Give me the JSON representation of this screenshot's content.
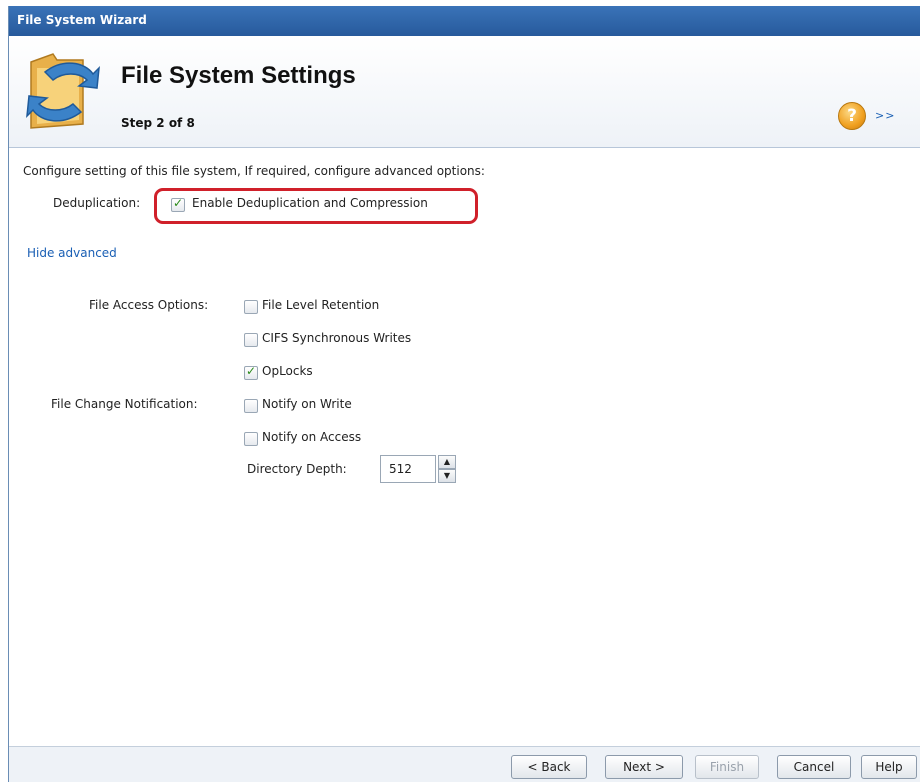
{
  "window": {
    "title": "File System Wizard"
  },
  "header": {
    "title": "File System Settings",
    "step": "Step 2 of 8",
    "help_icon_text": "?",
    "expand_text": ">>"
  },
  "content": {
    "intro": "Configure setting of this file system, If required, configure advanced options:",
    "dedup_label": "Deduplication:",
    "dedup_option": {
      "label": "Enable Deduplication and Compression",
      "checked": true
    },
    "advanced_link": "Hide advanced",
    "file_access_label": "File Access Options:",
    "file_access_options": [
      {
        "label": "File Level Retention",
        "checked": false
      },
      {
        "label": "CIFS Synchronous Writes",
        "checked": false
      },
      {
        "label": "OpLocks",
        "checked": true
      }
    ],
    "file_change_label": "File Change Notification:",
    "file_change_options": [
      {
        "label": "Notify on Write",
        "checked": false
      },
      {
        "label": "Notify on Access",
        "checked": false
      }
    ],
    "directory_depth": {
      "label": "Directory Depth:",
      "value": "512"
    }
  },
  "footer": {
    "back": "< Back",
    "next": "Next >",
    "finish": "Finish",
    "cancel": "Cancel",
    "help": "Help"
  },
  "colors": {
    "title_bar": "#2f66ac",
    "link": "#1a5fb4",
    "highlight": "#d0202a",
    "check": "#2a8a1a"
  }
}
